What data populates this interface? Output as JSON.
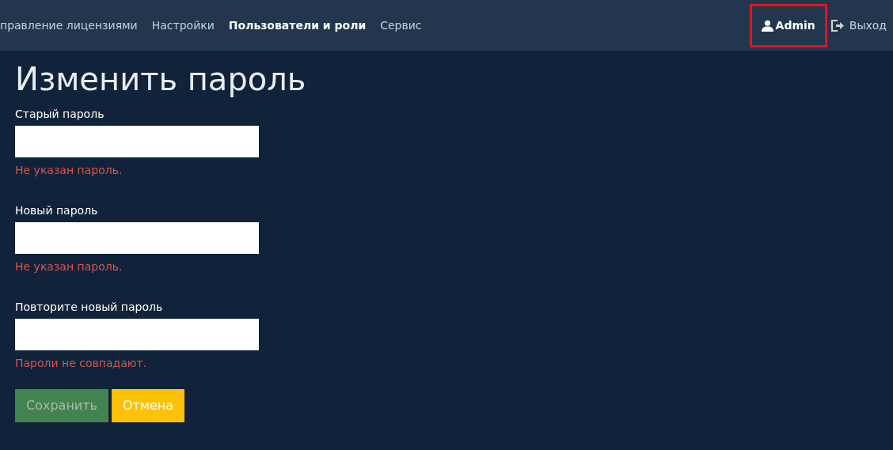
{
  "navbar": {
    "items": [
      {
        "label": "правление лицензиями",
        "selected": false
      },
      {
        "label": "Настройки",
        "selected": false
      },
      {
        "label": "Пользователи и роли",
        "selected": true
      },
      {
        "label": "Сервис",
        "selected": false
      }
    ],
    "user": {
      "label": "Admin",
      "highlighted": true
    },
    "logout": {
      "label": "Выход"
    }
  },
  "title": "Изменить пароль",
  "fields": [
    {
      "label": "Старый пароль",
      "error": "Не указан пароль."
    },
    {
      "label": "Новый пароль",
      "error": "Не указан пароль."
    },
    {
      "label": "Повторите новый пароль",
      "error": "Пароли не совпадают."
    }
  ],
  "buttons": [
    {
      "label": "Сохранить",
      "kind": "save",
      "disabled": true
    },
    {
      "label": "Отмена",
      "kind": "cancel",
      "disabled": false
    }
  ]
}
